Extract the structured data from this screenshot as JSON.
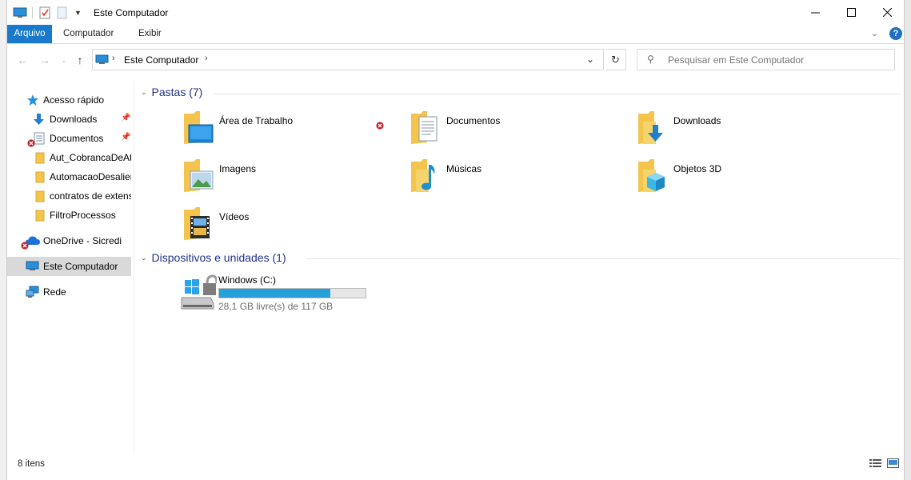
{
  "window": {
    "title": "Este Computador",
    "minimize_label": "—",
    "maximize_label": "☐",
    "close_label": "✕"
  },
  "ribbon": {
    "tabs": [
      "Arquivo",
      "Computador",
      "Exibir"
    ],
    "help_label": "?"
  },
  "address": {
    "crumb": "Este Computador",
    "separator": "›"
  },
  "search": {
    "placeholder": "Pesquisar em Este Computador"
  },
  "sidebar": {
    "items": [
      {
        "label": "Acesso rápido",
        "icon": "star-icon"
      },
      {
        "label": "Downloads",
        "icon": "download-arrow-icon",
        "pinned": true
      },
      {
        "label": "Documentos",
        "icon": "document-icon",
        "pinned": true,
        "error": true
      },
      {
        "label": "Aut_CobrancaDeAti",
        "icon": "folder-icon"
      },
      {
        "label": "AutomacaoDesalier",
        "icon": "folder-icon"
      },
      {
        "label": "contratos de extens",
        "icon": "folder-icon"
      },
      {
        "label": "FiltroProcessos",
        "icon": "folder-icon"
      },
      {
        "label": "OneDrive - Sicredi",
        "icon": "cloud-icon",
        "error": true
      },
      {
        "label": "Este Computador",
        "icon": "computer-icon",
        "selected": true
      },
      {
        "label": "Rede",
        "icon": "network-icon"
      }
    ]
  },
  "content": {
    "folders_header": "Pastas (7)",
    "folders": [
      {
        "label": "Área de Trabalho",
        "icon": "desktop-folder-icon"
      },
      {
        "label": "Documentos",
        "icon": "documents-folder-icon",
        "error": true
      },
      {
        "label": "Downloads",
        "icon": "downloads-folder-icon"
      },
      {
        "label": "Imagens",
        "icon": "pictures-folder-icon"
      },
      {
        "label": "Músicas",
        "icon": "music-folder-icon"
      },
      {
        "label": "Objetos 3D",
        "icon": "3d-objects-folder-icon"
      },
      {
        "label": "Vídeos",
        "icon": "videos-folder-icon"
      }
    ],
    "devices_header": "Dispositivos e unidades (1)",
    "drives": [
      {
        "label": "Windows (C:)",
        "free_text": "28,1 GB livre(s) de 117 GB",
        "used_fraction": 0.76
      }
    ]
  },
  "status": {
    "items_count": "8 itens"
  },
  "colors": {
    "accent": "#1979ca",
    "group_header": "#1e3287",
    "drive_bar": "#26a0da",
    "folder_yellow": "#f4c44c"
  }
}
